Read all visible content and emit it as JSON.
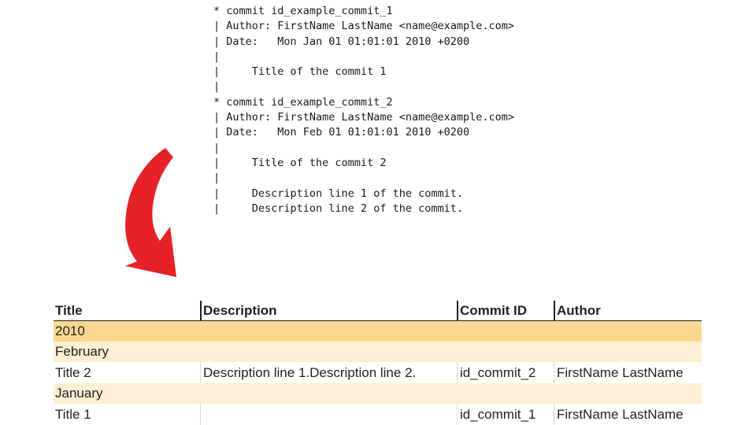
{
  "git_log": {
    "lines": [
      "* commit id_example_commit_1",
      "| Author: FirstName LastName <name@example.com>",
      "| Date:   Mon Jan 01 01:01:01 2010 +0200",
      "|",
      "|     Title of the commit 1",
      "|",
      "* commit id_example_commit_2",
      "| Author: FirstName LastName <name@example.com>",
      "| Date:   Mon Feb 01 01:01:01 2010 +0200",
      "|",
      "|     Title of the commit 2",
      "|",
      "|     Description line 1 of the commit.",
      "|     Description line 2 of the commit."
    ]
  },
  "arrow": {
    "icon": "curved-arrow-icon",
    "color": "#e5222a"
  },
  "table": {
    "headers": {
      "title": "Title",
      "description": "Description",
      "commit_id": "Commit ID",
      "author": "Author"
    },
    "year_group": "2010",
    "groups": [
      {
        "month": "February",
        "row": {
          "title": "Title 2",
          "description": "Description line 1.Description line 2.",
          "commit_id": "id_commit_2",
          "author": "FirstName LastName"
        }
      },
      {
        "month": "January",
        "row": {
          "title": "Title 1",
          "description": "",
          "commit_id": "id_commit_1",
          "author": "FirstName LastName"
        }
      }
    ],
    "colors": {
      "year_fill": "#f9d890",
      "month_fill": "#fcefd3"
    }
  }
}
